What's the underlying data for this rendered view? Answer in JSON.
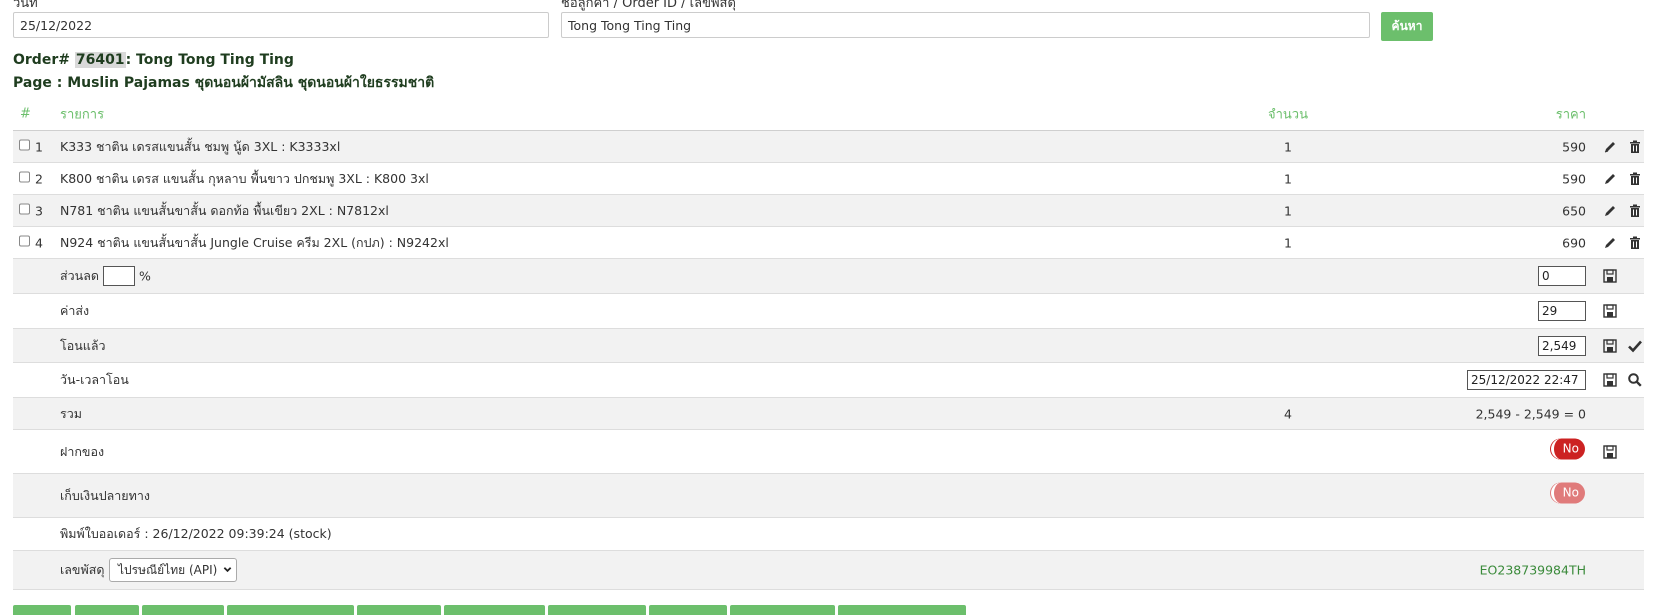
{
  "search": {
    "date_label": "วันที่",
    "date_value": "25/12/2022",
    "query_label": "ชื่อลูกค้า / Order ID / เลขพัสดุ",
    "query_value": "Tong Tong Ting Ting",
    "search_button": "ค้นหา"
  },
  "order": {
    "prefix": "Order#",
    "id": "76401",
    "customer": ": Tong Tong Ting Ting",
    "page_line": "Page : Muslin Pajamas ชุดนอนผ้ามัสลิน ชุดนอนผ้าใยธรรมชาติ"
  },
  "table": {
    "headers": {
      "num": "#",
      "item": "รายการ",
      "qty": "จำนวน",
      "price": "ราคา"
    },
    "items": [
      {
        "num": "1",
        "name": "K333 ชาติน เดรสแขนสั้น ชมพู นู้ด 3XL : K3333xl",
        "qty": "1",
        "price": "590"
      },
      {
        "num": "2",
        "name": "K800 ชาติน เดรส แขนสั้น กุหลาบ พื้นขาว ปกชมพู 3XL : K800 3xl",
        "qty": "1",
        "price": "590"
      },
      {
        "num": "3",
        "name": "N781 ชาติน แขนสั้นขาสั้น ดอกท้อ พื้นเขียว 2XL : N7812xl",
        "qty": "1",
        "price": "650"
      },
      {
        "num": "4",
        "name": "N924 ชาติน แขนสั้นขาสั้น Jungle Cruise ครีม 2XL (กปภ) : N9242xl",
        "qty": "1",
        "price": "690"
      }
    ]
  },
  "summary": {
    "discount_label": "ส่วนลด",
    "discount_percent_value": "",
    "percent_sign": "%",
    "discount_value": "0",
    "shipping_label": "ค่าส่ง",
    "shipping_value": "29",
    "paid_label": "โอนแล้ว",
    "paid_value": "2,549",
    "paid_datetime_label": "วัน-เวลาโอน",
    "paid_datetime_value": "25/12/2022 22:47",
    "total_label": "รวม",
    "total_qty": "4",
    "total_calc": "2,549 - 2,549 = 0",
    "deposit_label": "ฝากของ",
    "deposit_toggle": "No",
    "cod_label": "เก็บเงินปลายทาง",
    "cod_toggle": "No",
    "printed_line": "พิมพ์ใบออเดอร์ : 26/12/2022 09:39:24 (stock)",
    "tracking_label": "เลขพัสดุ",
    "carrier_selected": "ไปรษณีย์ไทย (API)",
    "tracking_number": "EO238739984TH"
  },
  "colors": {
    "accent": "#6cbf6c",
    "toggle_off": "#cc2222",
    "row_alt": "#f2f2f2"
  },
  "icons": {
    "edit": "pencil-icon",
    "delete": "trash-icon",
    "save": "floppy-disk-icon",
    "confirm": "checkmark-icon",
    "search": "magnifier-icon"
  }
}
